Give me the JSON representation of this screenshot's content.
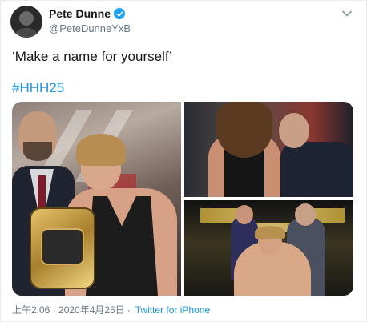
{
  "author": {
    "display_name": "Pete Dunne",
    "handle": "@PeteDunneYxB",
    "verified_icon": "verified-badge-icon",
    "avatar_icon": "profile-avatar"
  },
  "tweet": {
    "text": "‘Make a name for yourself’",
    "hashtag": "#HHH25"
  },
  "media": {
    "photos": [
      "photo-1",
      "photo-2",
      "photo-3"
    ]
  },
  "footer": {
    "timestamp": "上午2:06 · 2020年4月25日",
    "separator": "·",
    "source": "Twitter for iPhone"
  },
  "colors": {
    "link": "#1b95e0",
    "verified": "#1da1f2",
    "secondary_text": "#657786"
  }
}
